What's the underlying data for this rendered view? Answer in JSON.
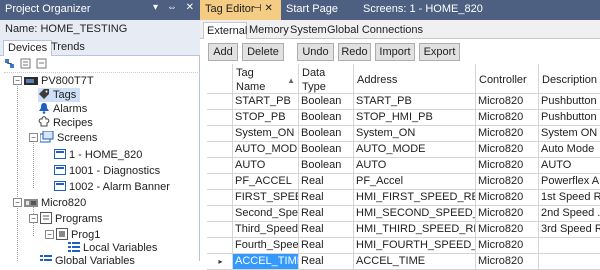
{
  "project_organizer": {
    "title": "Project Organizer",
    "window_controls": "▾ ⇔ ✕",
    "name_label": "Name:",
    "name_value": "HOME_TESTING",
    "tabs": [
      "Devices",
      "Trends"
    ],
    "tree": {
      "device": "PV800T7T",
      "tags": "Tags",
      "alarms": "Alarms",
      "recipes": "Recipes",
      "screens": "Screens",
      "screen_items": [
        "1 - HOME_820",
        "1001 - Diagnostics",
        "1002 - Alarm Banner"
      ],
      "controller": "Micro820",
      "programs": "Programs",
      "prog1": "Prog1",
      "local_vars": "Local Variables",
      "global_vars": "Global Variables"
    }
  },
  "doc_tabs": {
    "tag_editor": "Tag Editor",
    "pin_close": "⊣ ✕",
    "start_page": "Start Page",
    "screens": "Screens: 1 - HOME_820"
  },
  "sub_tabs": [
    "External",
    "Memory",
    "System",
    "Global Connections"
  ],
  "toolbar": [
    "Add",
    "Delete",
    "Undo",
    "Redo",
    "Import",
    "Export"
  ],
  "table": {
    "headers": {
      "tag_name_1": "Tag",
      "tag_name_2": "Name",
      "data_type_1": "Data",
      "data_type_2": "Type",
      "address": "Address",
      "controller": "Controller",
      "description": "Description"
    },
    "rows": [
      {
        "name": "START_PB",
        "type": "Boolean",
        "address": "START_PB",
        "controller": "Micro820",
        "description": "Pushbutton ..."
      },
      {
        "name": "STOP_PB",
        "type": "Boolean",
        "address": "STOP_HMI_PB",
        "controller": "Micro820",
        "description": "Pushbutton ..."
      },
      {
        "name": "System_ON",
        "type": "Boolean",
        "address": "System_ON",
        "controller": "Micro820",
        "description": "System ON"
      },
      {
        "name": "AUTO_MODE",
        "type": "Boolean",
        "address": "AUTO_MODE",
        "controller": "Micro820",
        "description": "Auto Mode"
      },
      {
        "name": "AUTO",
        "type": "Boolean",
        "address": "AUTO",
        "controller": "Micro820",
        "description": "AUTO"
      },
      {
        "name": "PF_ACCEL",
        "type": "Real",
        "address": "PF_Accel",
        "controller": "Micro820",
        "description": "Powerflex A..."
      },
      {
        "name": "FIRST_SPEED",
        "type": "Real",
        "address": "HMI_FIRST_SPEED_REF",
        "controller": "Micro820",
        "description": "1st Speed R..."
      },
      {
        "name": "Second_Spe...",
        "type": "Real",
        "address": "HMI_SECOND_SPEED_REF",
        "controller": "Micro820",
        "description": "2nd Speed ..."
      },
      {
        "name": "Third_Speed",
        "type": "Real",
        "address": "HMI_THIRD_SPEED_REF",
        "controller": "Micro820",
        "description": "3rd Speed R..."
      },
      {
        "name": "Fourth_Speed",
        "type": "Real",
        "address": "HMI_FOURTH_SPEED_REF",
        "controller": "Micro820",
        "description": ""
      },
      {
        "name": "ACCEL_TIME",
        "type": "Real",
        "address": "ACCEL_TIME",
        "controller": "Micro820",
        "description": ""
      }
    ],
    "current_row_marker": "▸"
  },
  "colors": {
    "title_bar": "#4d6082",
    "active_doc_tab": "#f5cc84",
    "selection": "#3399ff"
  }
}
